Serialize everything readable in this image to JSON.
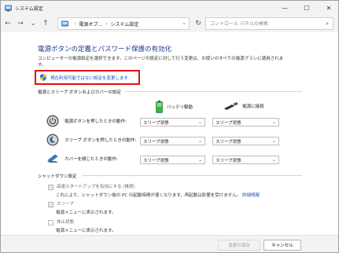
{
  "window": {
    "title": "システム設定",
    "controls": {
      "minimize": "—",
      "maximize": "☐",
      "close": "✕"
    }
  },
  "nav": {
    "back": "←",
    "forward": "→",
    "recent": "⌄",
    "up": "↑",
    "breadcrumb": [
      "電源オプ...",
      "システム設定"
    ],
    "breadcrumb_sep": "›",
    "refresh": "↻",
    "search_placeholder": "コントロール パネルの検索"
  },
  "main": {
    "title": "電源ボタンの定義とパスワード保護の有効化",
    "description": "コンピューターの電源設定を選択できます。このページの設定に対して行う変更は、お使いのすべての電源プランに適用されます。",
    "unavailable_link": "現在利用可能ではない設定を変更します"
  },
  "power_section": {
    "heading": "電源とスリープ ボタンおよびカバーの設定",
    "col_battery": "バッテリ駆動",
    "col_plugged": "電源に接続",
    "rows": [
      {
        "label": "電源ボタンを押したときの動作:",
        "battery": "スリープ状態",
        "plugged": "スリープ状態"
      },
      {
        "label": "スリープ ボタンを押したときの動作:",
        "battery": "スリープ状態",
        "plugged": "スリープ状態"
      },
      {
        "label": "カバーを閉じたときの動作:",
        "battery": "スリープ状態",
        "plugged": "スリープ状態"
      }
    ]
  },
  "shutdown_section": {
    "heading": "シャットダウン設定",
    "items": [
      {
        "label": "高速スタートアップを有効にする (推奨)",
        "sub": "これにより、シャットダウン後の PC の起動時間が速くなります。再起動は影響を受けません。",
        "link": "詳細情報",
        "checked": true
      },
      {
        "label": "スリープ",
        "sub": "電源メニューに表示されます。",
        "checked": true
      },
      {
        "label": "休止状態",
        "sub": "電源メニューに表示されます。",
        "checked": false
      }
    ]
  },
  "footer": {
    "save": "変更の保存",
    "cancel": "キャンセル"
  },
  "colors": {
    "accent": "#1a55b5",
    "title_blue": "#1e3a8a",
    "highlight": "#e01010"
  }
}
